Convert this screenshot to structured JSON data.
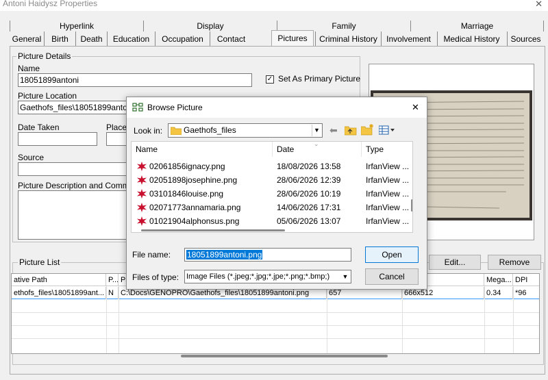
{
  "window": {
    "title": "Antoni Haidysz Properties",
    "close_glyph": "✕"
  },
  "tabs_back": [
    "Hyperlink",
    "Display",
    "Family",
    "Marriage"
  ],
  "tabs_front": [
    "General",
    "Birth",
    "Death",
    "Education",
    "Occupation",
    "Contact",
    "Pictures",
    "Criminal History",
    "Involvement",
    "Medical History",
    "Sources"
  ],
  "picture_details": {
    "group_label": "Picture Details",
    "name_label": "Name",
    "name_value": "18051899antoni",
    "primary_label": "Set As Primary Picture",
    "primary_checked": "✓",
    "location_label": "Picture Location",
    "location_value": "Gaethofs_files\\18051899antoni",
    "date_label": "Date Taken",
    "place_label": "Place",
    "source_label": "Source",
    "description_label": "Picture Description and Comments"
  },
  "picture_list": {
    "group_label": "Picture List",
    "edit_button": "Edit...",
    "remove_button": "Remove",
    "columns": [
      "ative Path",
      "P...",
      "Pa",
      "",
      "ion",
      "Mega...",
      "DPI"
    ],
    "rows": [
      [
        "ethofs_files\\18051899ant...",
        "N",
        "C:\\Docs\\GENOPRO\\Gaethofs_files\\18051899antoni.png",
        "657",
        "666x512",
        "0.34",
        "*96"
      ]
    ]
  },
  "dialog": {
    "title": "Browse Picture",
    "close_glyph": "✕",
    "look_in_label": "Look in:",
    "look_in_value": "Gaethofs_files",
    "columns": [
      "Name",
      "Date",
      "Type"
    ],
    "files": [
      {
        "name": "02061856ignacy.png",
        "date": "18/08/2026 13:58",
        "type": "IrfanView ..."
      },
      {
        "name": "02051898josephine.png",
        "date": "28/06/2026 12:39",
        "type": "IrfanView ..."
      },
      {
        "name": "03101846louise.png",
        "date": "28/06/2026 10:19",
        "type": "IrfanView ..."
      },
      {
        "name": "02071773annamaria.png",
        "date": "14/06/2026 17:31",
        "type": "IrfanView ..."
      },
      {
        "name": "01021904alphonsus.png",
        "date": "05/06/2026 13:07",
        "type": "IrfanView ..."
      }
    ],
    "filename_label": "File name:",
    "filename_value": "18051899antoni.png",
    "filetype_label": "Files of type:",
    "filetype_value": "Image Files (*.jpeg;*.jpg;*.jpe;*.png;*.bmp;)",
    "open_button": "Open",
    "cancel_button": "Cancel"
  },
  "colors": {
    "accent": "#0078d7",
    "selection": "#3399ff",
    "folder": "#f4c542"
  }
}
